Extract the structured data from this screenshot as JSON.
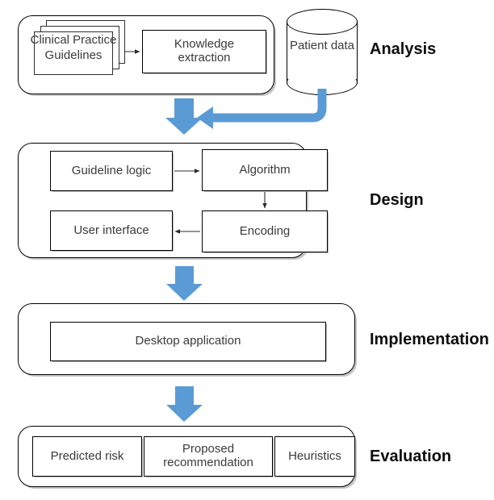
{
  "diagram": {
    "title": "Clinical decision support development methodology",
    "accent_blue": "#5B9BD5",
    "text_color": "#3a3a3a",
    "line_color": "#000000"
  },
  "stages": [
    {
      "key": "analysis",
      "label": "Analysis",
      "nodes": [
        {
          "key": "cpg",
          "label": "Clinical Practice Guidelines",
          "shape": "stacked-document"
        },
        {
          "key": "knowledge_extraction",
          "line1": "Knowledge",
          "line2": "extraction",
          "shape": "rectangle"
        },
        {
          "key": "patient_data",
          "line1": "Patient",
          "line2": "data",
          "shape": "cylinder"
        }
      ]
    },
    {
      "key": "design",
      "label": "Design",
      "nodes": [
        {
          "key": "guideline_logic",
          "label": "Guideline logic",
          "shape": "rectangle"
        },
        {
          "key": "algorithm",
          "label": "Algorithm",
          "shape": "rectangle"
        },
        {
          "key": "encoding",
          "label": "Encoding",
          "shape": "rectangle"
        },
        {
          "key": "user_interface",
          "label": "User interface",
          "shape": "rectangle"
        }
      ]
    },
    {
      "key": "implementation",
      "label": "Implementation",
      "nodes": [
        {
          "key": "desktop_application",
          "label": "Desktop application",
          "shape": "rectangle"
        }
      ]
    },
    {
      "key": "evaluation",
      "label": "Evaluation",
      "nodes": [
        {
          "key": "predicted_risk",
          "label": "Predicted risk",
          "shape": "rectangle"
        },
        {
          "key": "proposed_recommendation",
          "line1": "Proposed",
          "line2": "recommendation",
          "shape": "rectangle"
        },
        {
          "key": "heuristics",
          "label": "Heuristics",
          "shape": "rectangle"
        }
      ]
    }
  ],
  "labels": {
    "cpg_line1": "Clinical",
    "cpg_line2": "Practice",
    "cpg_line3": "Guidelines",
    "knowledge_line1": "Knowledge",
    "knowledge_line2": "extraction",
    "patient_line1": "Patient",
    "patient_line2": "data",
    "guideline_logic": "Guideline logic",
    "algorithm": "Algorithm",
    "encoding": "Encoding",
    "user_interface": "User interface",
    "desktop_application": "Desktop application",
    "predicted_risk": "Predicted risk",
    "proposed_line1": "Proposed",
    "proposed_line2": "recommendation",
    "heuristics": "Heuristics",
    "stage_analysis": "Analysis",
    "stage_design": "Design",
    "stage_implementation": "Implementation",
    "stage_evaluation": "Evaluation"
  },
  "connectors": [
    {
      "key": "cpg-to-knowledge",
      "style": "thin-arrow",
      "direction": "right"
    },
    {
      "key": "patient-data-to-analysis-flow",
      "style": "blue-elbow-arrow",
      "direction": "left"
    },
    {
      "key": "analysis-to-design",
      "style": "blue-block-arrow",
      "direction": "down"
    },
    {
      "key": "guideline-logic-to-algorithm",
      "style": "thin-arrow",
      "direction": "right"
    },
    {
      "key": "algorithm-to-encoding",
      "style": "thin-arrow",
      "direction": "down"
    },
    {
      "key": "encoding-to-user-interface",
      "style": "thin-arrow",
      "direction": "left"
    },
    {
      "key": "design-to-implementation",
      "style": "blue-block-arrow",
      "direction": "down"
    },
    {
      "key": "implementation-to-evaluation",
      "style": "blue-block-arrow",
      "direction": "down"
    }
  ]
}
